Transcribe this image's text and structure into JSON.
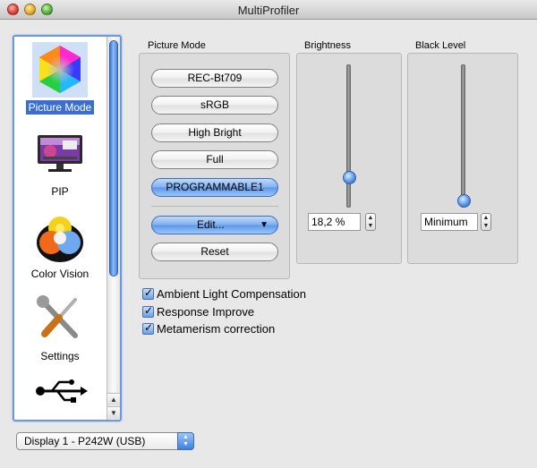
{
  "window": {
    "title": "MultiProfiler"
  },
  "sidebar": {
    "items": [
      {
        "label": "Picture Mode",
        "icon": "color-hexagon-icon",
        "selected": true
      },
      {
        "label": "PIP",
        "icon": "monitor-icon",
        "selected": false
      },
      {
        "label": "Color Vision",
        "icon": "color-vision-icon",
        "selected": false
      },
      {
        "label": "Settings",
        "icon": "tools-icon",
        "selected": false
      },
      {
        "label": "",
        "icon": "usb-icon",
        "selected": false
      }
    ]
  },
  "picture_mode": {
    "label": "Picture Mode",
    "modes": [
      {
        "label": "REC-Bt709",
        "active": false
      },
      {
        "label": "sRGB",
        "active": false
      },
      {
        "label": "High Bright",
        "active": false
      },
      {
        "label": "Full",
        "active": false
      },
      {
        "label": "PROGRAMMABLE1",
        "active": true
      }
    ],
    "edit_label": "Edit...",
    "reset_label": "Reset"
  },
  "brightness": {
    "label": "Brightness",
    "value": "18,2 %",
    "level": 0.182
  },
  "black_level": {
    "label": "Black Level",
    "value": "Minimum",
    "level": 0.0
  },
  "options": [
    {
      "label": "Ambient Light Compensation",
      "checked": true
    },
    {
      "label": "Response Improve",
      "checked": true
    },
    {
      "label": "Metamerism correction",
      "checked": true
    }
  ],
  "display_select": {
    "value": "Display 1 - P242W (USB)"
  },
  "colors": {
    "accent": "#3a6fd1",
    "active_button": "#5a97ea"
  }
}
